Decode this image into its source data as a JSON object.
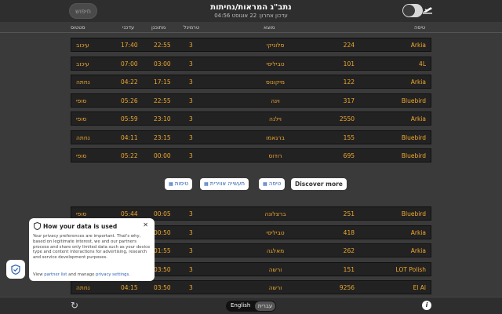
{
  "header": {
    "title": "נתב\"ג המראות/נחיתות",
    "subtitle": "עדכון אחרון: 22 אוגוסט 04:56",
    "search_label": "חיפוש"
  },
  "columns": {
    "airline": "טיסה",
    "destination": "מוצא",
    "terminal": "טרמינל",
    "planned": "מתוכנן",
    "updated": "עדכני",
    "status": "סטטוס"
  },
  "rows_top": [
    {
      "airline": "Arkia",
      "flight": "224",
      "destination": "סלוניקי",
      "terminal": "3",
      "planned": "22:55",
      "updated": "17:40",
      "status": "עיכוב"
    },
    {
      "airline": "4L",
      "flight": "101",
      "destination": "טביליסי",
      "terminal": "3",
      "planned": "03:00",
      "updated": "07:00",
      "status": "עיכוב"
    },
    {
      "airline": "Arkia",
      "flight": "122",
      "destination": "מיקונוס",
      "terminal": "3",
      "planned": "17:15",
      "updated": "04:22",
      "status": "נחתה"
    },
    {
      "airline": "Bluebird",
      "flight": "317",
      "destination": "וינה",
      "terminal": "3",
      "planned": "22:55",
      "updated": "05:26",
      "status": "סופי"
    },
    {
      "airline": "Arkia",
      "flight": "2550",
      "destination": "וילנה",
      "terminal": "3",
      "planned": "23:10",
      "updated": "05:59",
      "status": "סופי"
    },
    {
      "airline": "Bluebird",
      "flight": "155",
      "destination": "ברגאמו",
      "terminal": "3",
      "planned": "23:15",
      "updated": "04:11",
      "status": "נחתה"
    },
    {
      "airline": "Bluebird",
      "flight": "695",
      "destination": "רודוס",
      "terminal": "3",
      "planned": "00:00",
      "updated": "05:22",
      "status": "סופי"
    }
  ],
  "rows_bottom": [
    {
      "airline": "Bluebird",
      "flight": "251",
      "destination": "ברצלונה",
      "terminal": "3",
      "planned": "00:05",
      "updated": "05:44",
      "status": "סופי"
    },
    {
      "airline": "Arkia",
      "flight": "418",
      "destination": "טביליסי",
      "terminal": "3",
      "planned": "00:50",
      "updated": "",
      "status": ""
    },
    {
      "airline": "Arkia",
      "flight": "262",
      "destination": "מאלגה",
      "terminal": "3",
      "planned": "01:55",
      "updated": "",
      "status": ""
    },
    {
      "airline": "LOT Polish",
      "flight": "151",
      "destination": "ורשה",
      "terminal": "3",
      "planned": "03:50",
      "updated": "",
      "status": ""
    },
    {
      "airline": "El Al",
      "flight": "9256",
      "destination": "ורשה",
      "terminal": "3",
      "planned": "03:50",
      "updated": "04:15",
      "status": "נחתה"
    }
  ],
  "filters": {
    "more": "Discover more",
    "flight": "טיסה",
    "aviation_industry": "תעשייה אווירית",
    "flights": "טיסות"
  },
  "footer": {
    "lang_en": "English",
    "lang_he": "עברית"
  },
  "privacy": {
    "title": "How your data is used",
    "body": "Your privacy preferences are important. That's why, based on legitimate interest, we and our partners process and share only limited data such as your device type and content interactions for advertising, research and service development purposes.",
    "view": "View",
    "partner_list": "partner list",
    "and_manage": "and manage",
    "settings": "privacy settings."
  }
}
